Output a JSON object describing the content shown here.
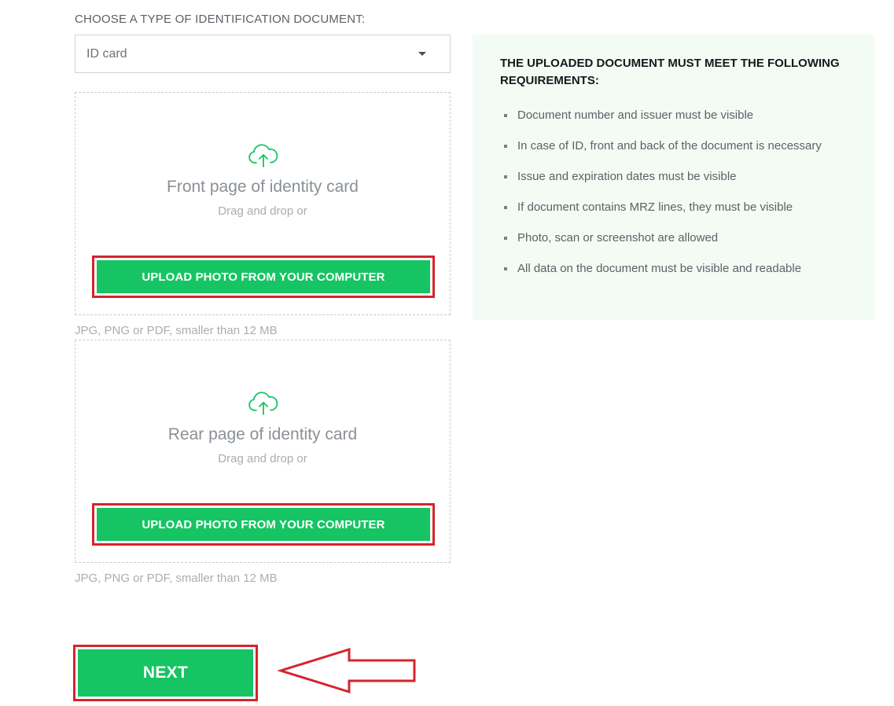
{
  "form": {
    "doc_type_label": "CHOOSE A TYPE OF IDENTIFICATION DOCUMENT:",
    "doc_type_selected": "ID card"
  },
  "front": {
    "title": "Front page of identity card",
    "subtitle": "Drag and drop or",
    "upload_label": "UPLOAD PHOTO FROM YOUR COMPUTER",
    "hint": "JPG, PNG or PDF, smaller than 12 MB"
  },
  "rear": {
    "title": "Rear page of identity card",
    "subtitle": "Drag and drop or",
    "upload_label": "UPLOAD PHOTO FROM YOUR COMPUTER",
    "hint": "JPG, PNG or PDF, smaller than 12 MB"
  },
  "requirements": {
    "title": "THE UPLOADED DOCUMENT MUST MEET THE FOLLOWING REQUIREMENTS:",
    "items": [
      "Document number and issuer must be visible",
      "In case of ID, front and back of the document is necessary",
      "Issue and expiration dates must be visible",
      "If document contains MRZ lines, they must be visible",
      "Photo, scan or screenshot are allowed",
      "All data on the document must be visible and readable"
    ]
  },
  "next_label": "NEXT",
  "colors": {
    "accent": "#16c463",
    "highlight": "#d6232d",
    "panel_bg": "#f3fbf5"
  },
  "icons": {
    "upload": "cloud-upload-icon",
    "dropdown": "caret-down-icon",
    "callout": "arrow-left-icon"
  }
}
